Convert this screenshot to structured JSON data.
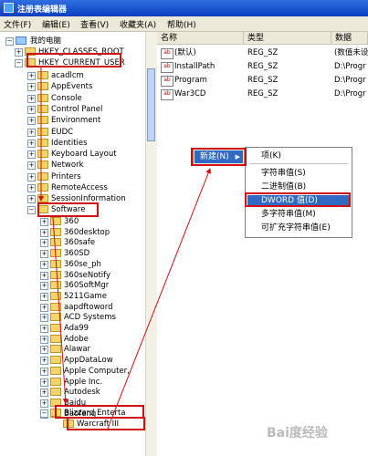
{
  "window": {
    "title": "注册表编辑器"
  },
  "menu": [
    "文件(F)",
    "编辑(E)",
    "查看(V)",
    "收藏夹(A)",
    "帮助(H)"
  ],
  "tree": {
    "root": "我的电脑",
    "hkcr": "HKEY_CLASSES_ROOT",
    "hkcu": "HKEY_CURRENT_USER",
    "hkcu_children": [
      "acadlcm",
      "AppEvents",
      "Console",
      "Control Panel",
      "Environment",
      "EUDC",
      "Identities",
      "Keyboard Layout",
      "Network",
      "Printers",
      "RemoteAccess",
      "SessionInformation"
    ],
    "software": "Software",
    "software_children": [
      "360",
      "360desktop",
      "360safe",
      "360SD",
      "360se_ph",
      "360seNotify",
      "360SoftMgr",
      "5211Game",
      "aapdftoword",
      "ACD Systems",
      "Ada99",
      "Adobe",
      "Alawar",
      "AppDataLow",
      "Apple Computer,",
      "Apple Inc.",
      "Autodesk",
      "Baidu",
      "Baofeng"
    ],
    "blizzard": "Blizzard Enterta",
    "warcraft": "Warcraft III"
  },
  "values_table": {
    "headers": [
      "名称",
      "类型",
      "数据"
    ],
    "rows": [
      {
        "name": "(默认)",
        "type": "REG_SZ",
        "data": "(数值未设"
      },
      {
        "name": "InstallPath",
        "type": "REG_SZ",
        "data": "D:\\Progr"
      },
      {
        "name": "Program",
        "type": "REG_SZ",
        "data": "D:\\Progr"
      },
      {
        "name": "War3CD",
        "type": "REG_SZ",
        "data": "D:\\Progr"
      }
    ],
    "icon_label": "ab"
  },
  "context_menu": {
    "new_label": "新建(N)",
    "arrow": "▶",
    "items": [
      "项(K)",
      "字符串值(S)",
      "二进制值(B)",
      "DWORD 值(D)",
      "多字符串值(M)",
      "可扩充字符串值(E)"
    ]
  },
  "icons": {
    "expand": "+",
    "collapse": "−"
  },
  "watermark": "Bai度经验",
  "colors": {
    "highlight": "#316ac5",
    "annotation": "#d01010",
    "titlebar": "#0b3fc0"
  }
}
